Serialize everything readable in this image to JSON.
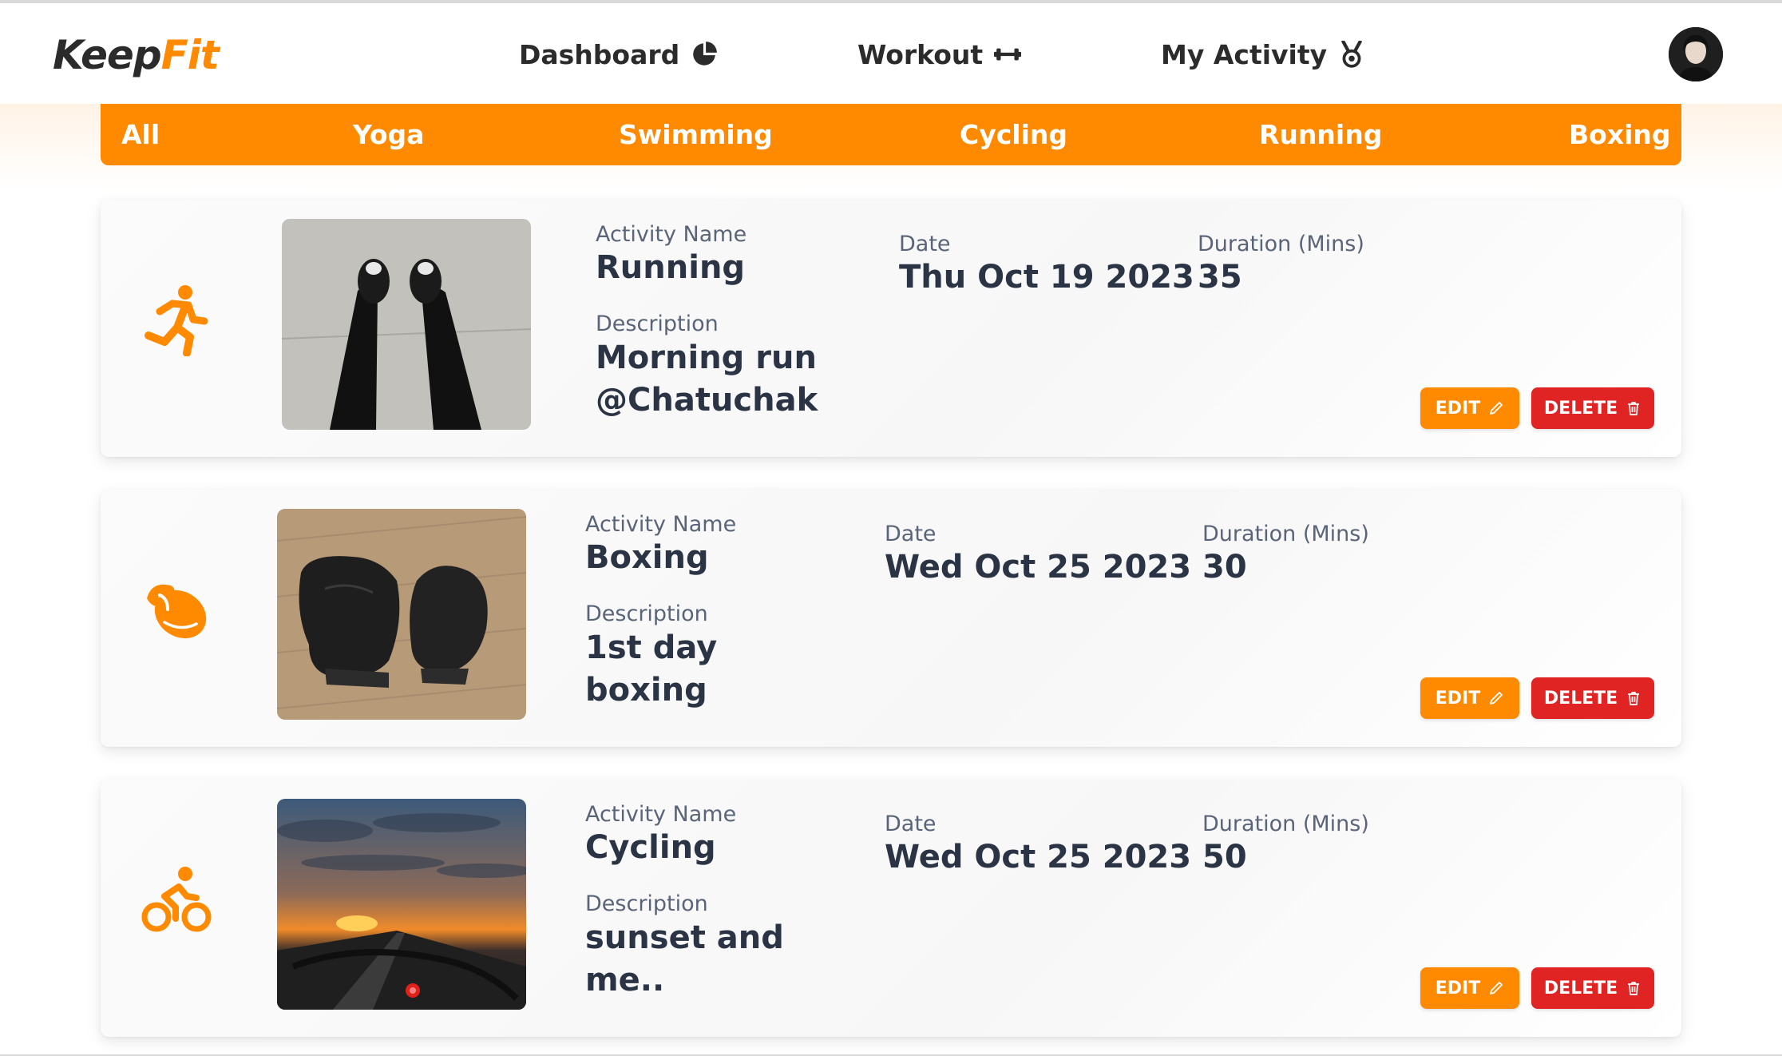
{
  "app": {
    "logo_keep": "Keep",
    "logo_fit": "Fit",
    "accent": "#ff8a00",
    "danger": "#e02424"
  },
  "nav": {
    "items": [
      {
        "label": "Dashboard",
        "icon": "pie-chart-icon"
      },
      {
        "label": "Workout",
        "icon": "dumbbell-icon"
      },
      {
        "label": "My Activity",
        "icon": "medal-icon"
      }
    ],
    "avatar_icon": "user-avatar"
  },
  "tabs": [
    "All",
    "Yoga",
    "Swimming",
    "Cycling",
    "Running",
    "Boxing"
  ],
  "labels": {
    "activity_name": "Activity Name",
    "description": "Description",
    "date": "Date",
    "duration": "Duration (Mins)",
    "edit": "EDIT",
    "delete": "DELETE"
  },
  "activities": [
    {
      "icon": "running-person-icon",
      "photo": "feet-on-pavement-photo",
      "name": "Running",
      "description": "Morning run @Chatuchak",
      "date": "Thu Oct 19 2023",
      "duration": "35"
    },
    {
      "icon": "boxing-glove-icon",
      "photo": "boxing-gloves-photo",
      "name": "Boxing",
      "description": "1st day boxing",
      "date": "Wed Oct 25 2023",
      "duration": "30"
    },
    {
      "icon": "cyclist-icon",
      "photo": "sunset-bike-photo",
      "name": "Cycling",
      "description": "sunset and me..",
      "date": "Wed Oct 25 2023",
      "duration": "50"
    }
  ]
}
